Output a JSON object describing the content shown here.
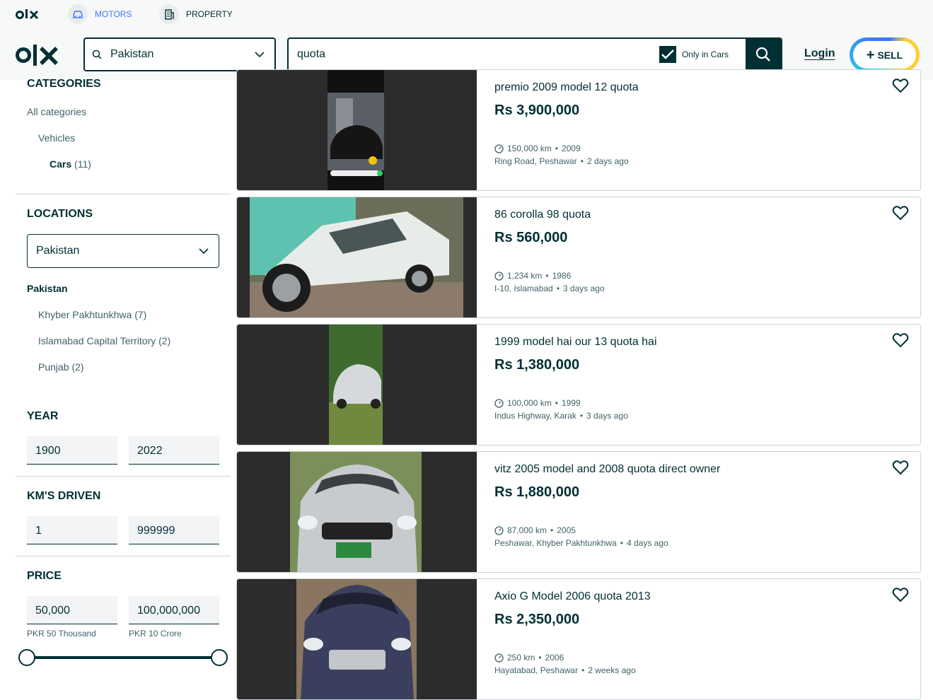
{
  "nav": {
    "motors_label": "MOTORS",
    "property_label": "PROPERTY"
  },
  "header": {
    "location_value": "Pakistan",
    "search_value": "quota",
    "only_in_label": "Only in Cars",
    "only_in_checked": true,
    "login_label": "Login",
    "sell_label": "SELL"
  },
  "sidebar": {
    "categories_heading": "CATEGORIES",
    "all_categories": "All categories",
    "vehicles": "Vehicles",
    "cars_label": "Cars",
    "cars_count": "(11)",
    "locations_heading": "LOCATIONS",
    "location_select_value": "Pakistan",
    "location_group": "Pakistan",
    "regions": [
      "Khyber Pakhtunkhwa (7)",
      "Islamabad Capital Territory (2)",
      "Punjab (2)"
    ],
    "year_heading": "YEAR",
    "year_min": "1900",
    "year_max": "2022",
    "km_heading": "KM'S DRIVEN",
    "km_min": "1",
    "km_max": "999999",
    "price_heading": "PRICE",
    "price_min": "50,000",
    "price_max": "100,000,000",
    "price_min_hint": "PKR 50 Thousand",
    "price_max_hint": "PKR 10 Crore"
  },
  "listings": [
    {
      "title": "premio 2009 model 12 quota",
      "price": "Rs 3,900,000",
      "km": "150,000 km",
      "year": "2009",
      "location": "Ring Road, Peshawar",
      "time": "2 days ago"
    },
    {
      "title": "86 corolla 98 quota",
      "price": "Rs 560,000",
      "km": "1,234 km",
      "year": "1986",
      "location": "I-10, Islamabad",
      "time": "3 days ago"
    },
    {
      "title": "1999 model hai our 13 quota hai",
      "price": "Rs 1,380,000",
      "km": "100,000 km",
      "year": "1999",
      "location": "Indus Highway, Karak",
      "time": "3 days ago"
    },
    {
      "title": "vitz 2005 model and 2008 quota direct owner",
      "price": "Rs 1,880,000",
      "km": "87,000 km",
      "year": "2005",
      "location": "Peshawar, Khyber Pakhtunkhwa",
      "time": "4 days ago"
    },
    {
      "title": "Axio G Model 2006 quota 2013",
      "price": "Rs 2,350,000",
      "km": "250 km",
      "year": "2006",
      "location": "Hayatabad, Peshawar",
      "time": "2 weeks ago"
    }
  ],
  "colors": {
    "brand_dark": "#002f34",
    "accent_blue": "#3a77ff",
    "sell_teal": "#23e5db",
    "sell_yellow": "#ffce32"
  }
}
